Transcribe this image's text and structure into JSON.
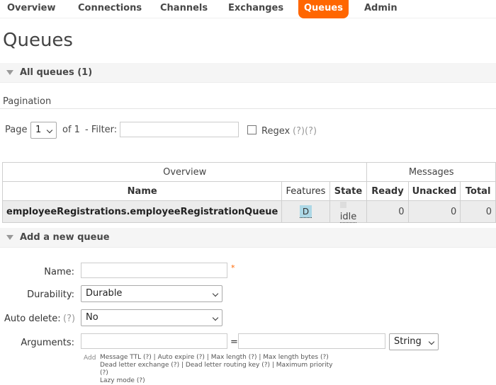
{
  "nav": {
    "items": [
      {
        "label": "Overview",
        "active": false
      },
      {
        "label": "Connections",
        "active": false
      },
      {
        "label": "Channels",
        "active": false
      },
      {
        "label": "Exchanges",
        "active": false
      },
      {
        "label": "Queues",
        "active": true
      },
      {
        "label": "Admin",
        "active": false
      }
    ],
    "active_color": "#ff6600"
  },
  "page_title": "Queues",
  "all_queues": {
    "label": "All queues (1)"
  },
  "pagination": {
    "title": "Pagination",
    "page_label": "Page",
    "page_value": "1",
    "of_label": "of 1",
    "filter_label": "- Filter:",
    "filter_value": "",
    "regex_label": "Regex",
    "regex_help": "(?)(?)"
  },
  "table": {
    "group_overview": "Overview",
    "group_messages": "Messages",
    "headers": [
      "Name",
      "Features",
      "State",
      "Ready",
      "Unacked",
      "Total"
    ],
    "rows": [
      {
        "name": "employeeRegistrations.employeeRegistrationQueue",
        "feature": "D",
        "state": "idle",
        "ready": "0",
        "unacked": "0",
        "total": "0"
      }
    ]
  },
  "add_queue": {
    "label": "Add a new queue",
    "name_label": "Name:",
    "name_value": "",
    "required_mark": "*",
    "durability_label": "Durability:",
    "durability_value": "Durable",
    "auto_delete_label": "Auto delete:",
    "auto_delete_help": "(?)",
    "auto_delete_value": "No",
    "arguments_label": "Arguments:",
    "arg_key": "",
    "equals": "=",
    "arg_value": "",
    "arg_type": "String",
    "add_label": "Add",
    "help_line1": "Message TTL (?) | Auto expire (?) | Max length (?) | Max length bytes (?)",
    "help_line2": "Dead letter exchange (?) | Dead letter routing key (?) | Maximum priority (?)",
    "help_line3": "Lazy mode (?)"
  }
}
